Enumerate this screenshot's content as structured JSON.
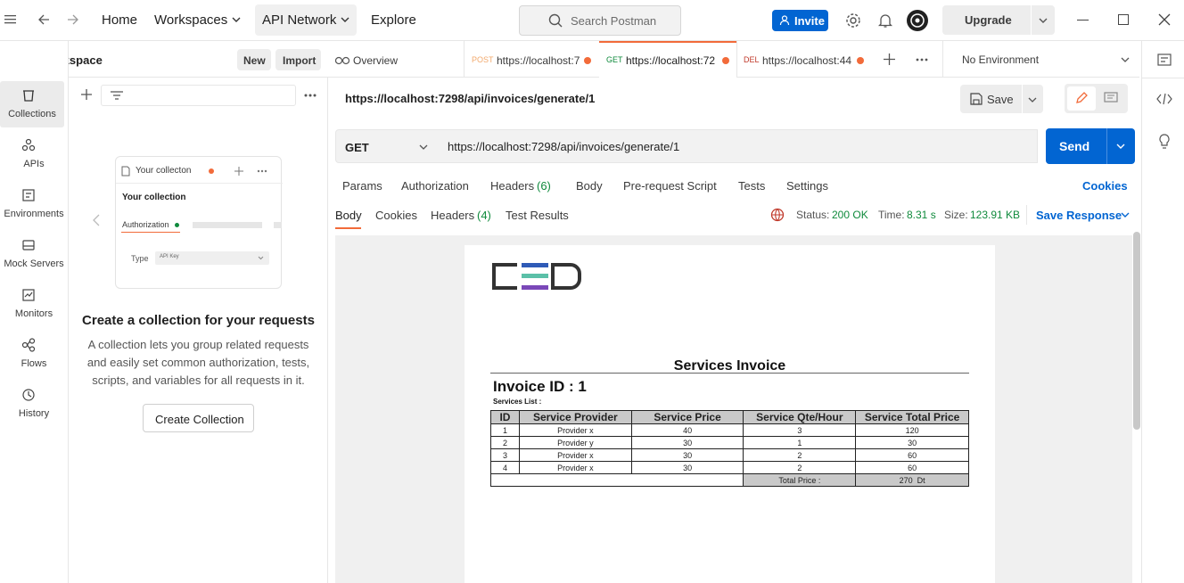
{
  "topbar": {
    "home": "Home",
    "workspaces": "Workspaces",
    "api_network": "API Network",
    "explore": "Explore",
    "search_placeholder": "Search Postman",
    "invite": "Invite",
    "upgrade": "Upgrade"
  },
  "workspace": {
    "name": "My Workspace",
    "new": "New",
    "import": "Import"
  },
  "rail": [
    {
      "label": "Collections",
      "icon": "collections-icon"
    },
    {
      "label": "APIs",
      "icon": "apis-icon"
    },
    {
      "label": "Environments",
      "icon": "environments-icon"
    },
    {
      "label": "Mock Servers",
      "icon": "mock-servers-icon"
    },
    {
      "label": "Monitors",
      "icon": "monitors-icon"
    },
    {
      "label": "Flows",
      "icon": "flows-icon"
    },
    {
      "label": "History",
      "icon": "history-icon"
    }
  ],
  "empty": {
    "card_title": "Your collecton",
    "card_heading": "Your collection",
    "card_auth": "Authorization",
    "card_type": "Type",
    "card_type_value": "API Key",
    "heading": "Create a collection for your requests",
    "desc1": "A collection lets you group related requests",
    "desc2": "and easily set common authorization, tests,",
    "desc3": "scripts, and variables for all requests in it.",
    "button": "Create Collection"
  },
  "tabs": [
    {
      "label": "Overview"
    },
    {
      "method": "POST",
      "label": "https://localhost:7"
    },
    {
      "method": "GET",
      "label": "https://localhost:72"
    },
    {
      "method": "DEL",
      "label": "https://localhost:44"
    }
  ],
  "environment": "No Environment",
  "request": {
    "title": "https://localhost:7298/api/invoices/generate/1",
    "save": "Save",
    "method": "GET",
    "url": "https://localhost:7298/api/invoices/generate/1",
    "send": "Send"
  },
  "req_tabs": {
    "params": "Params",
    "authorization": "Authorization",
    "headers": "Headers",
    "headers_count": "(6)",
    "body": "Body",
    "prerequest": "Pre-request Script",
    "tests": "Tests",
    "settings": "Settings",
    "cookies": "Cookies"
  },
  "resp_tabs": {
    "body": "Body",
    "cookies": "Cookies",
    "headers": "Headers",
    "headers_count": "(4)",
    "test_results": "Test Results"
  },
  "status": {
    "status_label": "Status:",
    "status_value": "200 OK",
    "time_label": "Time:",
    "time_value": "8.31 s",
    "size_label": "Size:",
    "size_value": "123.91 KB",
    "save_response": "Save Response"
  },
  "invoice": {
    "logo": "CED",
    "title": "Services Invoice",
    "invoice_id": "Invoice ID : 1",
    "list_label": "Services List :",
    "headers": [
      "ID",
      "Service Provider",
      "Service Price",
      "Service Qte/Hour",
      "Service Total Price"
    ],
    "rows": [
      [
        "1",
        "Provider x",
        "40",
        "3",
        "120"
      ],
      [
        "2",
        "Provider y",
        "30",
        "1",
        "30"
      ],
      [
        "3",
        "Provider x",
        "30",
        "2",
        "60"
      ],
      [
        "4",
        "Provider x",
        "30",
        "2",
        "60"
      ]
    ],
    "total_label": "Total Price :",
    "total_value": "270  Dt"
  },
  "colors": {
    "accent": "#0265d2",
    "orange": "#f26b3a",
    "status_green": "#0f8a3c"
  }
}
